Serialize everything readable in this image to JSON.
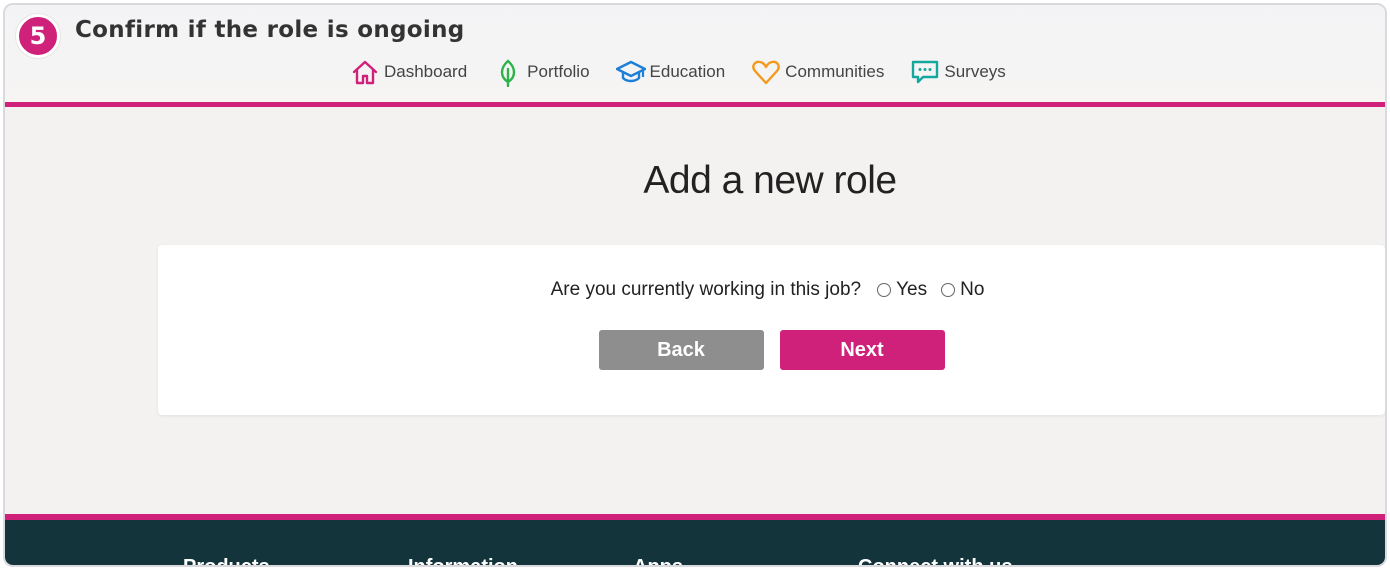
{
  "header": {
    "step_number": "5",
    "step_title": "Confirm if the role is ongoing"
  },
  "nav": {
    "items": [
      {
        "label": "Dashboard",
        "icon": "home-icon",
        "color": "#d0217a"
      },
      {
        "label": "Portfolio",
        "icon": "leaf-icon",
        "color": "#2db34a"
      },
      {
        "label": "Education",
        "icon": "graduation-cap-icon",
        "color": "#1e7fd8"
      },
      {
        "label": "Communities",
        "icon": "heart-icon",
        "color": "#f39a1e"
      },
      {
        "label": "Surveys",
        "icon": "chat-bubble-icon",
        "color": "#13a89e"
      }
    ]
  },
  "main": {
    "title": "Add a new role",
    "question": "Are you currently working in this job?",
    "options": [
      "Yes",
      "No"
    ],
    "back_label": "Back",
    "next_label": "Next"
  },
  "footer": {
    "columns": [
      "Products",
      "Information",
      "Apps",
      "Connect with us"
    ]
  },
  "colors": {
    "accent": "#d0217a",
    "footer_bg": "#14343b",
    "back_button": "#8e8e8e"
  }
}
